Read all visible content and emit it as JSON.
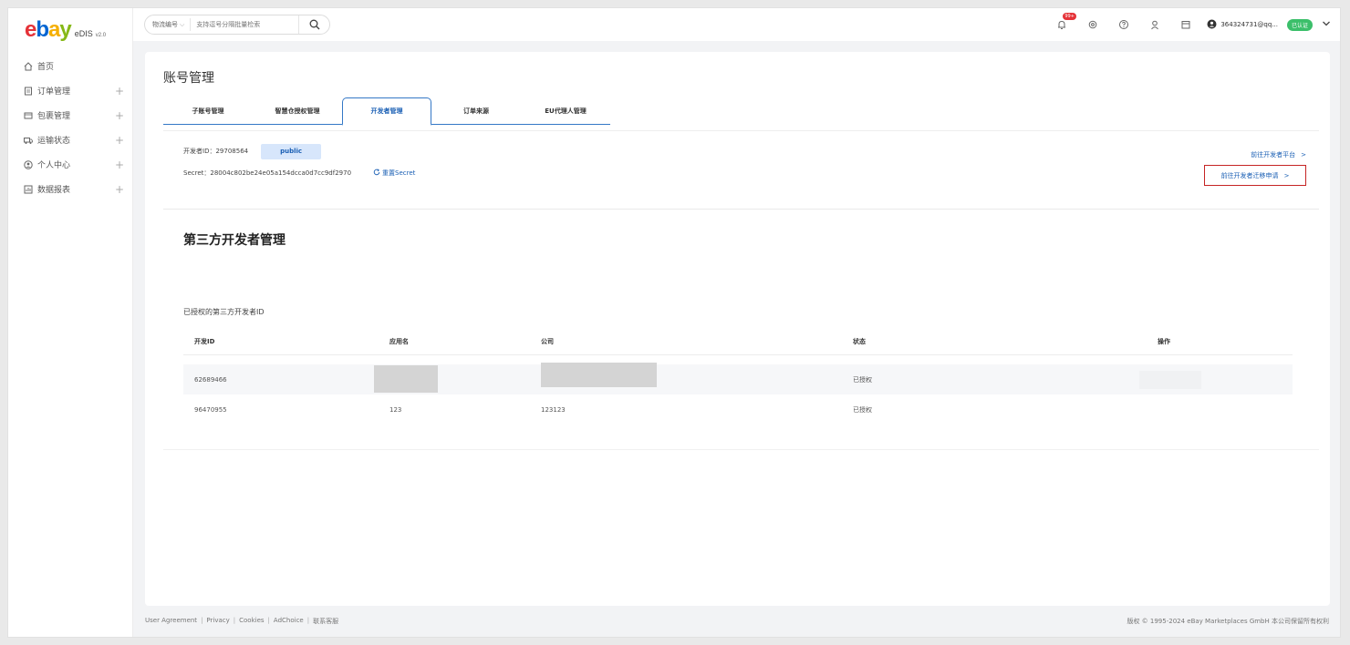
{
  "logo": {
    "brand": "eDIS",
    "version": "v2.0"
  },
  "sidebar": {
    "items": [
      {
        "label": "首页",
        "icon": "home-icon",
        "expandable": false
      },
      {
        "label": "订单管理",
        "icon": "order-icon",
        "expandable": true
      },
      {
        "label": "包裹管理",
        "icon": "package-icon",
        "expandable": true
      },
      {
        "label": "运输状态",
        "icon": "truck-icon",
        "expandable": true
      },
      {
        "label": "个人中心",
        "icon": "user-circle-icon",
        "expandable": true
      },
      {
        "label": "数据报表",
        "icon": "report-icon",
        "expandable": true
      }
    ],
    "plus": "+"
  },
  "topbar": {
    "search_type": "物流编号",
    "search_placeholder": "支持逗号分隔批量检索",
    "notification_count": "99+",
    "user_name": "364324731@qq...",
    "verified_label": "已认证"
  },
  "main": {
    "title": "账号管理",
    "tabs": [
      "子账号管理",
      "智慧仓授权管理",
      "开发者管理",
      "订单来源",
      "EU代理人管理"
    ],
    "active_tab": 2,
    "developer_id_label": "开发者ID：",
    "developer_id": "29708564",
    "developer_type": "public",
    "secret_label": "Secret：",
    "secret": "28004c802be24e05a154dcca0d7cc9df2970",
    "reset_secret": "重置Secret",
    "link_platform": "前往开发者平台",
    "link_migration": "前往开发者迁移申请",
    "chevron": ">",
    "section_title": "第三方开发者管理",
    "table_caption": "已授权的第三方开发者ID",
    "table": {
      "headers": [
        "开发ID",
        "应用名",
        "公司",
        "状态",
        "操作"
      ],
      "rows": [
        {
          "id": "62689466",
          "app": "",
          "company": "",
          "status": "已授权",
          "action": ""
        },
        {
          "id": "96470955",
          "app": "123",
          "company": "123123",
          "status": "已授权",
          "action": ""
        }
      ]
    }
  },
  "footer": {
    "links": [
      "User Agreement",
      "Privacy",
      "Cookies",
      "AdChoice",
      "联系客服"
    ],
    "separator": "|",
    "copyright": "版权 © 1995-2024 eBay Marketplaces GmbH 本公司保留所有权利"
  },
  "colors": {
    "accent": "#1a5fb4",
    "highlight_border": "#c52424",
    "verified": "#3bbf6a",
    "badge": "#e53238"
  }
}
